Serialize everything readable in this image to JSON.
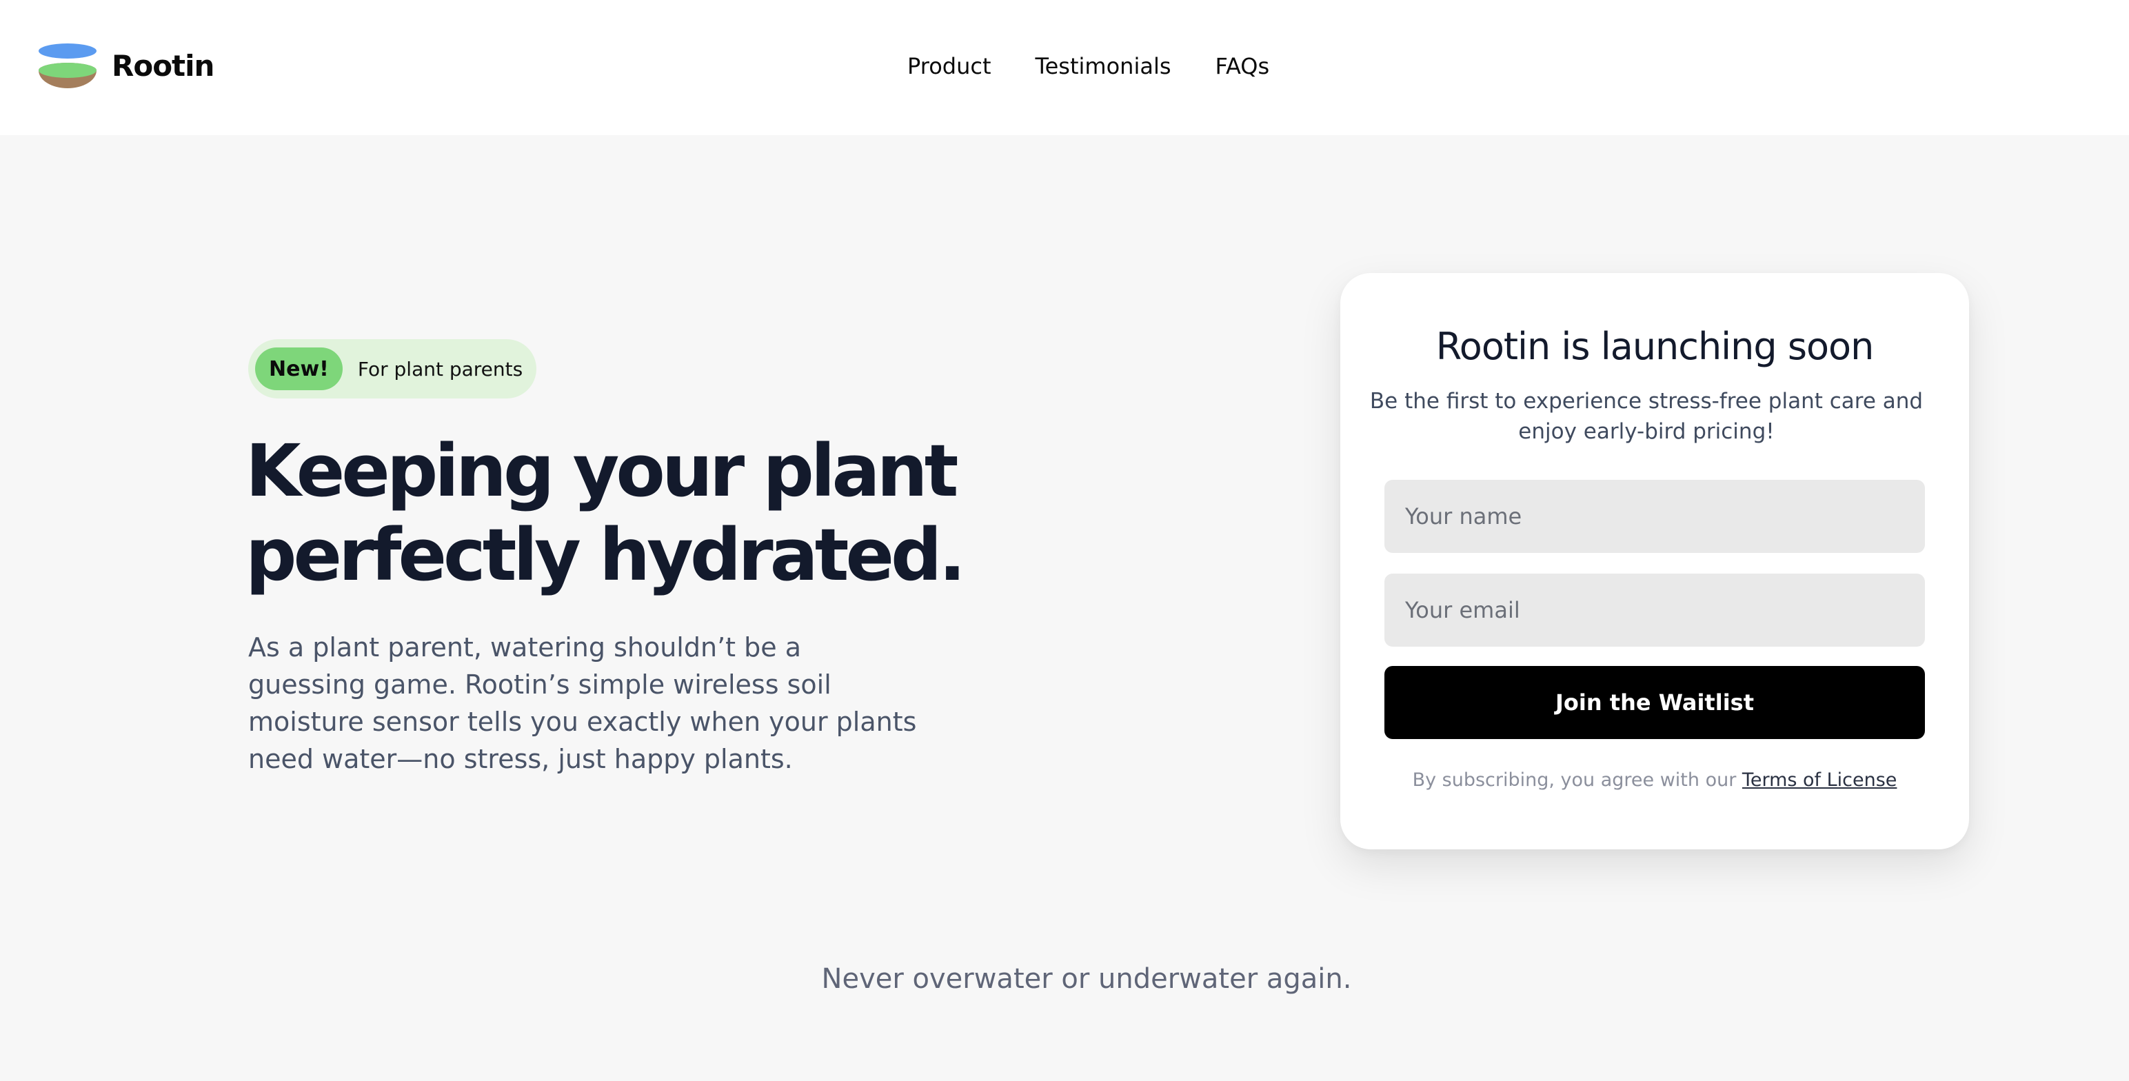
{
  "brand": {
    "name": "Rootin",
    "logo_colors": {
      "sky": "#5b9bf0",
      "grass": "#7ed67a",
      "soil": "#a47e5c"
    }
  },
  "nav": {
    "items": [
      "Product",
      "Testimonials",
      "FAQs"
    ]
  },
  "hero": {
    "badge_new": "New!",
    "badge_text": "For plant parents",
    "title": "Keeping your plant perfectly hydrated.",
    "description": "As a plant parent, watering shouldn’t be a guessing game. Rootin’s simple wireless soil moisture sensor tells you exactly when your plants need water—no stress, just happy plants."
  },
  "waitlist": {
    "title": "Rootin is launching soon",
    "subtitle": "Be the first to experience stress-free plant care and enjoy early-bird pricing!",
    "name_placeholder": "Your name",
    "email_placeholder": "Your email",
    "submit_label": "Join the Waitlist",
    "terms_prefix": "By subscribing, you agree with our",
    "terms_link": "Terms of License"
  },
  "tagline": "Never overwater or underwater again.",
  "colors": {
    "page_bg": "#f7f7f7",
    "header_bg": "#ffffff",
    "badge_bg": "#e1f3dc",
    "badge_new_bg": "#7ed67a",
    "button_bg": "#000000",
    "field_bg": "#e9e9e9",
    "heading": "#131a2c"
  }
}
